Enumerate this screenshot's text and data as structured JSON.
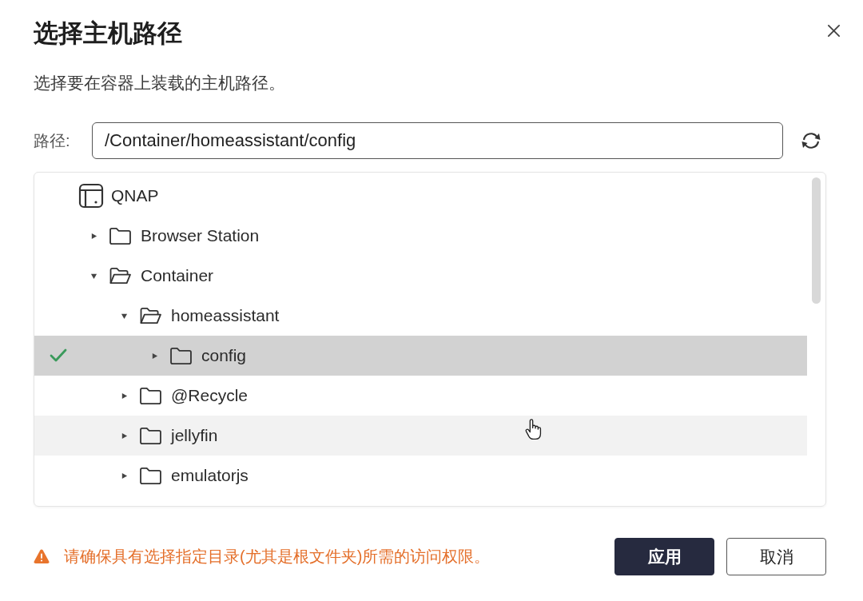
{
  "dialog": {
    "title": "选择主机路径",
    "description": "选择要在容器上装载的主机路径。"
  },
  "path_field": {
    "label": "路径:",
    "value": "/Container/homeassistant/config"
  },
  "tree": {
    "items": [
      {
        "label": "QNAP",
        "kind": "device",
        "selected": false,
        "hovered": false,
        "children": [
          {
            "label": "Browser Station",
            "kind": "folder",
            "expanded": false,
            "selected": false,
            "hovered": false
          },
          {
            "label": "Container",
            "kind": "folder",
            "expanded": true,
            "selected": false,
            "hovered": false,
            "children": [
              {
                "label": "homeassistant",
                "kind": "folder",
                "expanded": true,
                "selected": false,
                "hovered": false,
                "children": [
                  {
                    "label": "config",
                    "kind": "folder",
                    "expanded": false,
                    "selected": true,
                    "hovered": false
                  }
                ]
              },
              {
                "label": "@Recycle",
                "kind": "folder",
                "expanded": false,
                "selected": false,
                "hovered": false
              },
              {
                "label": "jellyfin",
                "kind": "folder",
                "expanded": false,
                "selected": false,
                "hovered": true
              },
              {
                "label": "emulatorjs",
                "kind": "folder",
                "expanded": false,
                "selected": false,
                "hovered": false
              }
            ]
          }
        ]
      }
    ]
  },
  "warning": {
    "text": "请确保具有选择指定目录(尤其是根文件夹)所需的访问权限。"
  },
  "buttons": [
    {
      "label": "应用",
      "kind": "primary"
    },
    {
      "label": "取消",
      "kind": "secondary"
    }
  ]
}
